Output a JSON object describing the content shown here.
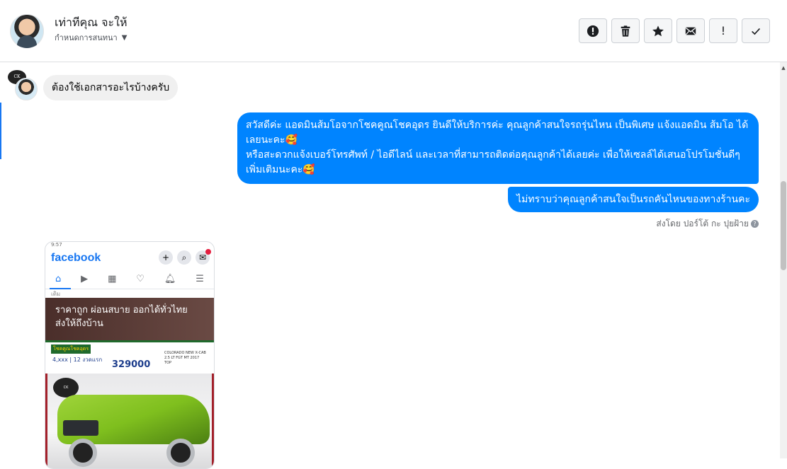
{
  "header": {
    "contact_name": "เท่าทีคุณ จะให้",
    "subtitle": "กำหนดการสนทนา"
  },
  "toolbar": {
    "buttons": [
      {
        "name": "report-spam",
        "icon": "alert-circle-icon"
      },
      {
        "name": "delete",
        "icon": "trash-icon"
      },
      {
        "name": "star",
        "icon": "star-icon"
      },
      {
        "name": "mark-unread",
        "icon": "envelope-icon"
      },
      {
        "name": "important",
        "icon": "exclamation-icon",
        "glyph": "!"
      },
      {
        "name": "mark-done",
        "icon": "check-icon"
      }
    ]
  },
  "thread": {
    "incoming_message": "ต้องใช้เอกสารอะไรบ้างครับ",
    "outgoing_message_1_line_1": "สวัสดีค่ะ แอดมินส้มโอจากโชคคูณโชคอุดร ยินดีให้บริการค่ะ   คุณลูกค้าสนใจรถรุ่นไหน เป็นพิเศษ แจ้งแอดมิน ส้มโอ ได้เลยนะคะ🥰",
    "outgoing_message_1_line_2": "หรือสะดวกแจ้งเบอร์โทรศัพท์ / ไอดีไลน์ และเวลาที่สามารถติดต่อคุณลูกค้าได้เลยค่ะ เพื่อให้เซลล์ได้เสนอโปรโมชั่นดีๆเพิ่มเติมนะคะ🥰",
    "outgoing_message_2": "ไม่ทราบว่าคุณลูกค้าสนใจเป็นรถคันไหนของทางร้านคะ",
    "sent_by": "ส่งโดย ปอร์โต้ กะ ปุยฝ้าย"
  },
  "attachment": {
    "status_bar": "9:57",
    "app_name": "facebook",
    "small_text": "เดิม",
    "banner_line_1": "ราคาถูก ผ่อนสบาย ออกได้ทั่วไทย",
    "banner_line_2": "ส่งให้ถึงบ้าน",
    "brand_label": "โชคคูณโชคอุดร",
    "down_payment": "4,xxx | 12 งวดแรก",
    "price": "329000",
    "model": "COLORADO NEW X-CAB 2.5 LT FGT MT 2017 TOP"
  },
  "colors": {
    "outgoing_bubble": "#0084ff",
    "incoming_bubble": "#f0f0f0",
    "facebook_blue": "#1877f2"
  }
}
